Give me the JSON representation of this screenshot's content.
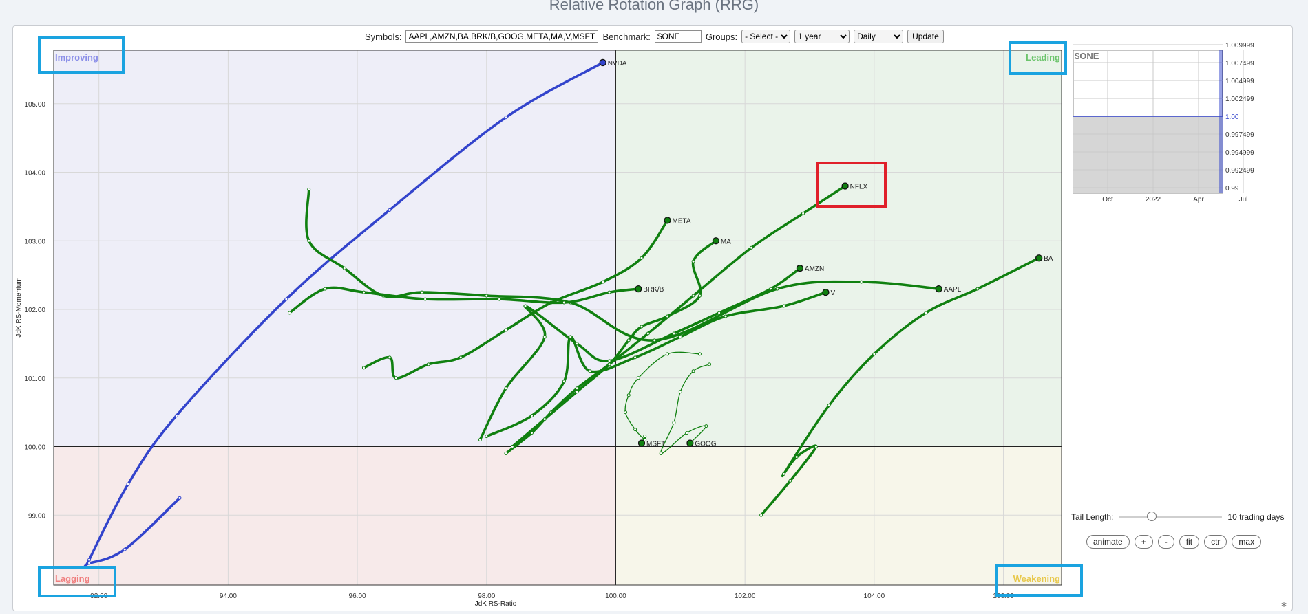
{
  "page": {
    "title": "Relative Rotation Graph (RRG)"
  },
  "toolbar": {
    "symbols_label": "Symbols:",
    "symbols_value": "AAPL,AMZN,BA,BRK/B,GOOG,META,MA,V,MSFT,NV",
    "benchmark_label": "Benchmark:",
    "benchmark_value": "$ONE",
    "groups_label": "Groups:",
    "groups_selected": "- Select -",
    "period_selected": "1 year",
    "frequency_selected": "Daily",
    "update_label": "Update"
  },
  "controls": {
    "tail_label": "Tail Length:",
    "tail_value_text": "10 trading days",
    "tail_slider_fraction": 0.32,
    "buttons": [
      "animate",
      "+",
      "-",
      "fit",
      "ctr",
      "max"
    ]
  },
  "colors": {
    "trail": "#108010",
    "nvda": "#3344cc",
    "highlight_box": "#1aa3e0",
    "nflx_box": "#e0202a"
  },
  "chart_data": {
    "type": "scatter",
    "xlabel": "JdK RS-Ratio",
    "ylabel": "JdK RS-Momentum",
    "xlim": [
      91.3,
      106.9
    ],
    "ylim": [
      97.98,
      105.78
    ],
    "x_ticks": [
      "92.00",
      "94.00",
      "96.00",
      "98.00",
      "100.00",
      "102.00",
      "104.00",
      "106.00"
    ],
    "y_ticks": [
      "99.00",
      "100.00",
      "101.00",
      "102.00",
      "103.00",
      "104.00",
      "105.00"
    ],
    "quadrants": {
      "top_left": "Improving",
      "top_right": "Leading",
      "bottom_left": "Lagging",
      "bottom_right": "Weakening"
    },
    "grid": true,
    "series": [
      {
        "name": "NVDA",
        "color": "#3344cc",
        "points": [
          [
            93.25,
            99.25
          ],
          [
            92.4,
            98.5
          ],
          [
            91.85,
            98.3
          ],
          [
            91.85,
            98.35
          ],
          [
            92.45,
            99.45
          ],
          [
            93.2,
            100.45
          ],
          [
            94.9,
            102.15
          ],
          [
            96.5,
            103.45
          ],
          [
            98.3,
            104.8
          ],
          [
            99.8,
            105.6
          ]
        ]
      },
      {
        "name": "NFLX",
        "color": "#108010",
        "points": [
          [
            98.3,
            99.9
          ],
          [
            98.7,
            100.2
          ],
          [
            99.0,
            100.5
          ],
          [
            99.4,
            100.85
          ],
          [
            99.9,
            101.2
          ],
          [
            100.5,
            101.65
          ],
          [
            101.2,
            102.2
          ],
          [
            102.1,
            102.9
          ],
          [
            102.9,
            103.4
          ],
          [
            103.55,
            103.8
          ]
        ]
      },
      {
        "name": "META",
        "color": "#108010",
        "points": [
          [
            96.1,
            101.15
          ],
          [
            96.5,
            101.3
          ],
          [
            96.6,
            101.0
          ],
          [
            97.1,
            101.2
          ],
          [
            97.6,
            101.3
          ],
          [
            98.3,
            101.7
          ],
          [
            99.0,
            102.1
          ],
          [
            99.8,
            102.4
          ],
          [
            100.4,
            102.75
          ],
          [
            100.8,
            103.3
          ]
        ]
      },
      {
        "name": "MA",
        "color": "#108010",
        "points": [
          [
            98.4,
            100.0
          ],
          [
            98.9,
            100.4
          ],
          [
            99.4,
            100.8
          ],
          [
            99.9,
            101.2
          ],
          [
            100.2,
            101.55
          ],
          [
            100.4,
            101.75
          ],
          [
            100.8,
            101.9
          ],
          [
            101.3,
            102.2
          ],
          [
            101.2,
            102.7
          ],
          [
            101.55,
            103.0
          ]
        ]
      },
      {
        "name": "AMZN",
        "color": "#108010",
        "points": [
          [
            97.9,
            100.1
          ],
          [
            98.3,
            100.85
          ],
          [
            98.9,
            101.6
          ],
          [
            98.6,
            102.05
          ],
          [
            99.4,
            101.5
          ],
          [
            99.9,
            101.25
          ],
          [
            100.9,
            101.65
          ],
          [
            101.6,
            101.95
          ],
          [
            102.4,
            102.3
          ],
          [
            102.85,
            102.6
          ]
        ]
      },
      {
        "name": "V",
        "color": "#108010",
        "points": [
          [
            98.0,
            100.15
          ],
          [
            98.7,
            100.45
          ],
          [
            99.2,
            100.95
          ],
          [
            99.3,
            101.6
          ],
          [
            99.6,
            101.1
          ],
          [
            100.3,
            101.3
          ],
          [
            101.0,
            101.6
          ],
          [
            101.7,
            101.9
          ],
          [
            102.6,
            102.05
          ],
          [
            103.25,
            102.25
          ]
        ]
      },
      {
        "name": "AAPL",
        "color": "#108010",
        "points": [
          [
            95.25,
            103.75
          ],
          [
            95.25,
            103.0
          ],
          [
            95.8,
            102.6
          ],
          [
            96.4,
            102.2
          ],
          [
            97.0,
            102.25
          ],
          [
            98.0,
            102.2
          ],
          [
            99.3,
            102.1
          ],
          [
            100.6,
            101.55
          ],
          [
            102.5,
            102.3
          ],
          [
            103.8,
            102.4
          ],
          [
            105.0,
            102.3
          ]
        ]
      },
      {
        "name": "BRK/B",
        "color": "#108010",
        "points": [
          [
            94.95,
            101.95
          ],
          [
            95.5,
            102.3
          ],
          [
            96.1,
            102.25
          ],
          [
            97.05,
            102.15
          ],
          [
            98.2,
            102.15
          ],
          [
            99.2,
            102.1
          ],
          [
            99.9,
            102.25
          ],
          [
            100.35,
            102.3
          ]
        ]
      },
      {
        "name": "BA",
        "color": "#108010",
        "points": [
          [
            102.25,
            99.0
          ],
          [
            102.7,
            99.5
          ],
          [
            103.1,
            100.0
          ],
          [
            102.8,
            99.85
          ],
          [
            102.6,
            99.6
          ],
          [
            103.3,
            100.6
          ],
          [
            104.0,
            101.35
          ],
          [
            104.8,
            101.95
          ],
          [
            105.6,
            102.3
          ],
          [
            106.55,
            102.75
          ]
        ]
      },
      {
        "name": "MSFT",
        "color": "#108010",
        "points": [
          [
            101.3,
            101.35
          ],
          [
            100.8,
            101.35
          ],
          [
            100.35,
            101.0
          ],
          [
            100.2,
            100.75
          ],
          [
            100.15,
            100.5
          ],
          [
            100.3,
            100.25
          ],
          [
            100.45,
            100.1
          ],
          [
            100.45,
            100.15
          ],
          [
            100.4,
            100.05
          ]
        ]
      },
      {
        "name": "GOOG",
        "color": "#108010",
        "points": [
          [
            101.45,
            101.2
          ],
          [
            101.2,
            101.1
          ],
          [
            101.0,
            100.8
          ],
          [
            100.9,
            100.35
          ],
          [
            100.7,
            99.9
          ],
          [
            101.1,
            100.2
          ],
          [
            101.4,
            100.3
          ],
          [
            101.15,
            100.05
          ]
        ]
      }
    ],
    "benchmark_panel": {
      "title": "$ONE",
      "x_ticks": [
        "Oct",
        "2022",
        "Apr",
        "Jul"
      ],
      "y_ticks": [
        "1.009999",
        "1.007499",
        "1.004999",
        "1.002499",
        "1.00",
        "0.997499",
        "0.994999",
        "0.992499",
        "0.99"
      ],
      "ylim": [
        0.99,
        1.01
      ],
      "value": 1.0
    }
  }
}
